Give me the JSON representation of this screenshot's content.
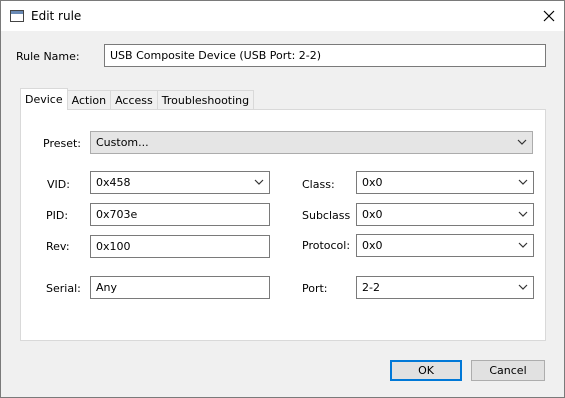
{
  "window": {
    "title": "Edit rule",
    "icon": "window-icon",
    "close_icon": "close-icon"
  },
  "rule": {
    "label": "Rule Name:",
    "value": "USB Composite Device (USB Port: 2-2)"
  },
  "tabs": [
    {
      "label": "Device",
      "active": true
    },
    {
      "label": "Action",
      "active": false
    },
    {
      "label": "Access",
      "active": false
    },
    {
      "label": "Troubleshooting",
      "active": false
    }
  ],
  "device": {
    "preset": {
      "label": "Preset:",
      "value": "Custom..."
    },
    "vid": {
      "label": "VID:",
      "value": "0x458"
    },
    "pid": {
      "label": "PID:",
      "value": "0x703e"
    },
    "rev": {
      "label": "Rev:",
      "value": "0x100"
    },
    "serial": {
      "label": "Serial:",
      "value": "Any"
    },
    "class": {
      "label": "Class:",
      "value": "0x0"
    },
    "subclass": {
      "label": "Subclass",
      "value": "0x0"
    },
    "protocol": {
      "label": "Protocol:",
      "value": "0x0"
    },
    "port": {
      "label": "Port:",
      "value": "2-2"
    }
  },
  "buttons": {
    "ok": "OK",
    "cancel": "Cancel"
  }
}
